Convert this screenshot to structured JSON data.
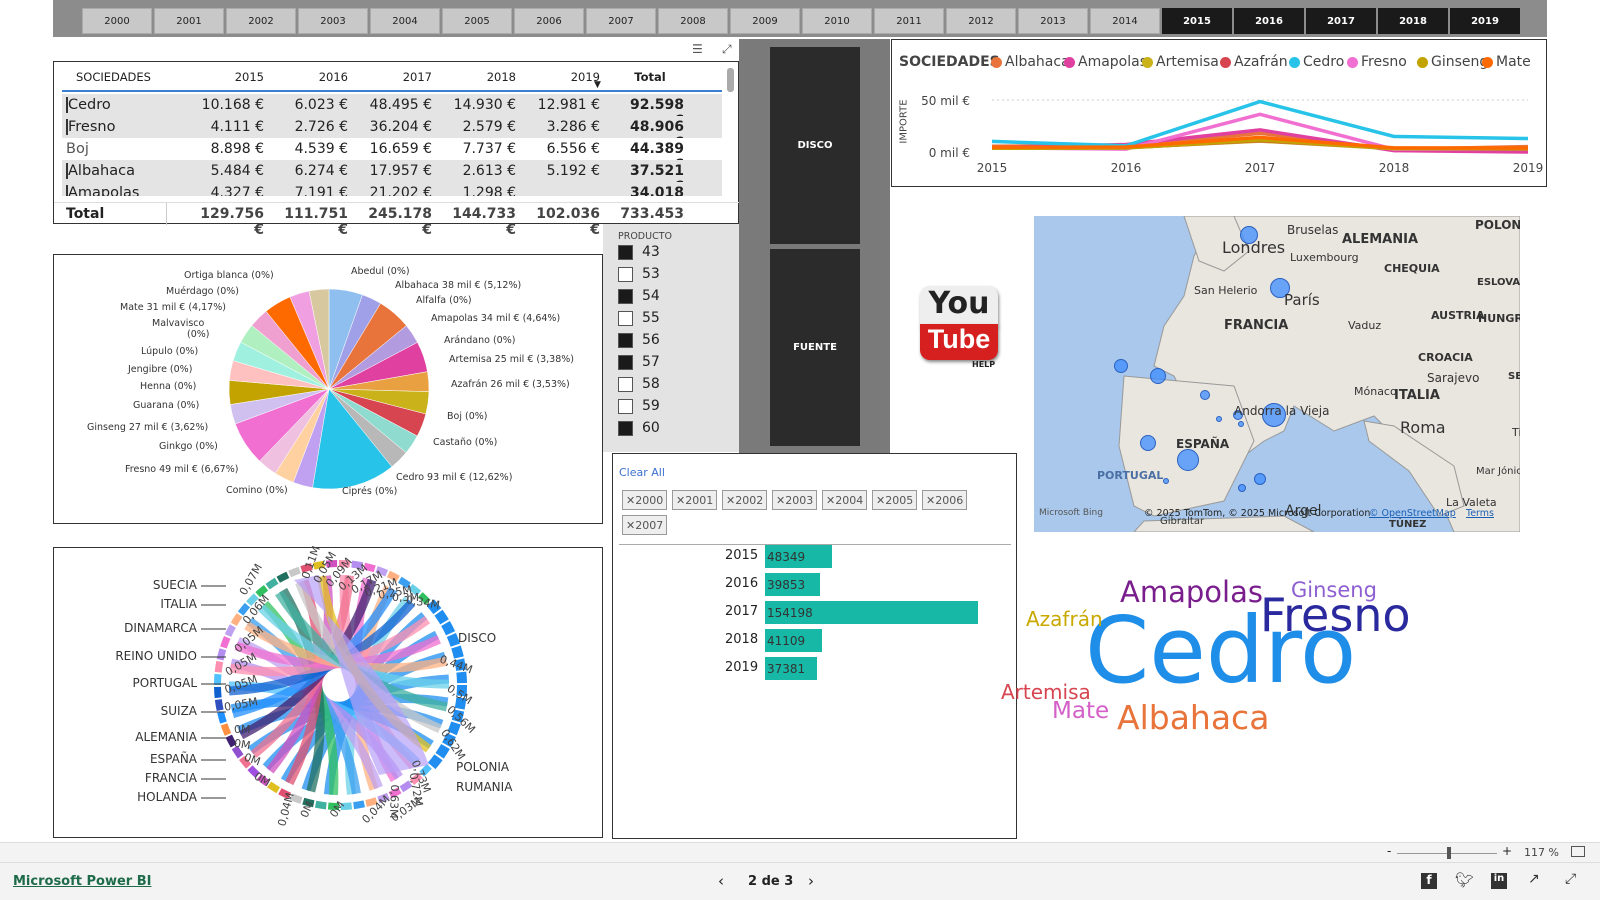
{
  "years": {
    "off": [
      "2000",
      "2001",
      "2002",
      "2003",
      "2004",
      "2005",
      "2006",
      "2007",
      "2008",
      "2009",
      "2010",
      "2011",
      "2012",
      "2013",
      "2014"
    ],
    "on": [
      "2015",
      "2016",
      "2017",
      "2018",
      "2019"
    ]
  },
  "matrix": {
    "headers": [
      "SOCIEDADES",
      "2015",
      "2016",
      "2017",
      "2018",
      "2019",
      "Total"
    ],
    "rows": [
      {
        "name": "Cedro",
        "v": [
          "10.168 €",
          "6.023 €",
          "48.495 €",
          "14.930 €",
          "12.981 €",
          "92.598 €"
        ]
      },
      {
        "name": "Fresno",
        "v": [
          "4.111 €",
          "2.726 €",
          "36.204 €",
          "2.579 €",
          "3.286 €",
          "48.906 €"
        ]
      },
      {
        "name": "Boj",
        "v": [
          "8.898 €",
          "4.539 €",
          "16.659 €",
          "7.737 €",
          "6.556 €",
          "44.389 €"
        ]
      },
      {
        "name": "Albahaca",
        "v": [
          "5.484 €",
          "6.274 €",
          "17.957 €",
          "2.613 €",
          "5.192 €",
          "37.521 €"
        ]
      },
      {
        "name": "Amapolas",
        "v": [
          "4.327 €",
          "7.191 €",
          "21.202 €",
          "1.298 €",
          "",
          "34.018 €"
        ]
      }
    ],
    "total": {
      "name": "Total",
      "v": [
        "129.756 €",
        "111.751 €",
        "245.178 €",
        "144.733 €",
        "102.036 €",
        "733.453 €"
      ]
    }
  },
  "pie": {
    "labels": {
      "ortiga": "Ortiga blanca (0%)",
      "muerdago": "Muérdago (0%)",
      "mate": "Mate 31 mil € (4,17%)",
      "malvavisco": "Malvavisco",
      "malvavisco_pct": "(0%)",
      "lupulo": "Lúpulo (0%)",
      "jengibre": "Jengibre (0%)",
      "henna": "Henna (0%)",
      "guarana": "Guarana (0%)",
      "ginseng": "Ginseng 27 mil € (3,62%)",
      "ginkgo": "Ginkgo (0%)",
      "fresno": "Fresno 49 mil € (6,67%)",
      "comino": "Comino (0%)",
      "cipres": "Ciprés (0%)",
      "cedro": "Cedro 93 mil € (12,62%)",
      "castano": "Castaño (0%)",
      "boj": "Boj (0%)",
      "azafran": "Azafrán 26 mil € (3,53%)",
      "artemisa": "Artemisa 25 mil € (3,38%)",
      "arandano": "Arándano (0%)",
      "amapolas": "Amapolas 34 mil € (4,64%)",
      "alfalfa": "Alfalfa (0%)",
      "albahaca": "Albahaca 38 mil € (5,12%)",
      "abedul": "Abedul (0%)"
    }
  },
  "product": {
    "title": "PRODUCTO",
    "items": [
      {
        "n": "43",
        "on": true
      },
      {
        "n": "53",
        "on": false
      },
      {
        "n": "54",
        "on": true
      },
      {
        "n": "55",
        "on": false
      },
      {
        "n": "56",
        "on": true
      },
      {
        "n": "57",
        "on": true
      },
      {
        "n": "58",
        "on": false
      },
      {
        "n": "59",
        "on": false
      },
      {
        "n": "60",
        "on": true
      }
    ]
  },
  "buttons": {
    "disco": "DISCO",
    "fuente": "FUENTE"
  },
  "youtube": {
    "you": "You",
    "tube": "Tube",
    "help": "HELP"
  },
  "chart_data": [
    {
      "type": "line",
      "title": "SOCIEDADES",
      "ylabel": "IMPORTE",
      "x": [
        "2015",
        "2016",
        "2017",
        "2018",
        "2019"
      ],
      "yticks": [
        "0 mil €",
        "50 mil €"
      ],
      "ylim": [
        0,
        60000
      ],
      "series": [
        {
          "name": "Albahaca",
          "color": "#e8743b",
          "values": [
            5484,
            6274,
            17957,
            2613,
            5192
          ]
        },
        {
          "name": "Amapolas",
          "color": "#e040a0",
          "values": [
            4327,
            7191,
            21202,
            1298,
            0
          ]
        },
        {
          "name": "Artemisa",
          "color": "#c9b21a",
          "values": [
            3800,
            4200,
            10500,
            3200,
            3000
          ]
        },
        {
          "name": "Azafrán",
          "color": "#d64550",
          "values": [
            3900,
            4100,
            11000,
            3500,
            3300
          ]
        },
        {
          "name": "Cedro",
          "color": "#27c3e8",
          "values": [
            10168,
            6023,
            48495,
            14930,
            12981
          ]
        },
        {
          "name": "Fresno",
          "color": "#f06fd0",
          "values": [
            4111,
            2726,
            36204,
            2579,
            3286
          ]
        },
        {
          "name": "Ginseng",
          "color": "#c2a300",
          "values": [
            3600,
            3900,
            11500,
            3300,
            3100
          ]
        },
        {
          "name": "Mate",
          "color": "#ff6a00",
          "values": [
            4500,
            4800,
            14000,
            4000,
            3800
          ]
        }
      ]
    },
    {
      "type": "bar",
      "categories": [
        "2015",
        "2016",
        "2017",
        "2018",
        "2019"
      ],
      "values": [
        48349,
        39853,
        154198,
        41109,
        37381
      ]
    }
  ],
  "map": {
    "labels": [
      "POLON",
      "Londres",
      "Bruselas",
      "ALEMANIA",
      "Luxembourg",
      "CHEQUIA",
      "ESLOVA",
      "San Helerio",
      "París",
      "AUSTRIA",
      "HUNGR",
      "FRANCIA",
      "Vaduz",
      "CROACIA",
      "Sarajevo",
      "SE",
      "Mónaco",
      "ITALIA",
      "Andorra la Vieja",
      "Roma",
      "Tira",
      "ESPAÑA",
      "PORTUGAL",
      "Mar Jónico",
      "La Valeta",
      "Argel",
      "TÚNEZ",
      "Gibraltar"
    ],
    "attribution": "© 2025 TomTom, © 2025 Microsoft Corporation",
    "osm": "© OpenStreetMap",
    "terms": "Terms",
    "bing": "Microsoft Bing"
  },
  "chord": {
    "countries": [
      "SUECIA",
      "ITALIA",
      "DINAMARCA",
      "REINO UNIDO",
      "PORTUGAL",
      "SUIZA",
      "ALEMANIA",
      "ESPAÑA",
      "FRANCIA",
      "HOLANDA"
    ],
    "right": [
      "DISCO",
      "POLONIA",
      "RUMANIA"
    ],
    "ticks_left": [
      "0,07M",
      "0,06M",
      "0,05M",
      "0,05M",
      "0,05M",
      "0,05M",
      "0M",
      "0M",
      "0M",
      "0M"
    ],
    "ticks_right": [
      "0,44M",
      "0,5M",
      "0,56M",
      "0,62M",
      "0,73M",
      "0,72M",
      "0,63M"
    ],
    "ticks_top": [
      "0,11M",
      "0,05M",
      "0,09M",
      "0,13M",
      "0,17M",
      "0,21M",
      "0,25M",
      "0,3M",
      "0,34M"
    ],
    "ticks_bottom": [
      "0,04M",
      "0M",
      "0M",
      "0,04M",
      "0,03M"
    ]
  },
  "filters": {
    "clear": "Clear All",
    "chips": [
      "2000",
      "2001",
      "2002",
      "2003",
      "2004",
      "2005",
      "2006",
      "2007"
    ]
  },
  "wordcloud": [
    {
      "w": "Cedro",
      "color": "#1f8ee8"
    },
    {
      "w": "Fresno",
      "color": "#2a2a9e"
    },
    {
      "w": "Amapolas",
      "color": "#7a1e8e"
    },
    {
      "w": "Albahaca",
      "color": "#e8743b"
    },
    {
      "w": "Ginseng",
      "color": "#8e5fd0"
    },
    {
      "w": "Azafrán",
      "color": "#c9a800"
    },
    {
      "w": "Artemisa",
      "color": "#d64550"
    },
    {
      "w": "Mate",
      "color": "#d45fc8"
    }
  ],
  "zoom": {
    "minus": "-",
    "plus": "+",
    "level": "117 %"
  },
  "footer": {
    "brand": "Microsoft Power BI",
    "page": "2 de 3"
  }
}
